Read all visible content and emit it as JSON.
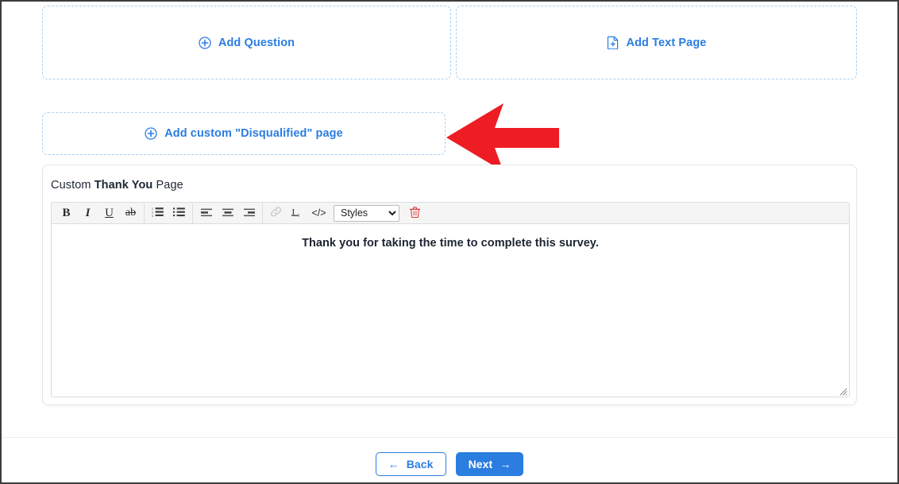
{
  "colors": {
    "accent_blue": "#2b7de0",
    "dashed_border": "#a9d2f3",
    "annotation_red": "#ee1c23",
    "toolbar_bg": "#f5f5f5",
    "card_border": "#e4e7eb",
    "trash_red": "#e03a3a"
  },
  "add_buttons": {
    "add_question": {
      "label": "Add Question",
      "icon": "plus-circle-icon"
    },
    "add_text_page": {
      "label": "Add Text Page",
      "icon": "file-plus-icon"
    },
    "add_disqualified": {
      "label": "Add custom \"Disqualified\" page",
      "icon": "plus-circle-icon"
    }
  },
  "annotation": {
    "type": "arrow",
    "direction": "left",
    "color": "#ee1c23",
    "points_at": "add custom \"Disqualified\" page"
  },
  "thank_you_card": {
    "title_prefix": "Custom ",
    "title_bold": "Thank You",
    "title_suffix": " Page",
    "editor": {
      "toolbar": [
        {
          "name": "bold-button",
          "glyph": "B",
          "label": "Bold",
          "disabled": false
        },
        {
          "name": "italic-button",
          "glyph": "I",
          "label": "Italic",
          "disabled": false
        },
        {
          "name": "underline-button",
          "glyph": "U",
          "label": "Underline",
          "disabled": false
        },
        {
          "name": "strikethrough-button",
          "glyph": "ab",
          "label": "Strikethrough",
          "disabled": false
        },
        {
          "name": "numbered-list-button",
          "glyph": "",
          "label": "Insert/Remove Numbered List",
          "disabled": false
        },
        {
          "name": "bulleted-list-button",
          "glyph": "",
          "label": "Insert/Remove Bulleted List",
          "disabled": false
        },
        {
          "name": "align-left-button",
          "glyph": "",
          "label": "Align Left",
          "disabled": false
        },
        {
          "name": "align-center-button",
          "glyph": "",
          "label": "Center",
          "disabled": false
        },
        {
          "name": "align-right-button",
          "glyph": "",
          "label": "Align Right",
          "disabled": false
        },
        {
          "name": "link-button",
          "glyph": "",
          "label": "Link",
          "disabled": true
        },
        {
          "name": "remove-format-button",
          "glyph": "Ix",
          "label": "Remove Format",
          "disabled": false
        },
        {
          "name": "source-code-button",
          "glyph": "</>",
          "label": "Source",
          "disabled": false
        },
        {
          "name": "delete-button",
          "glyph": "trash",
          "label": "Delete",
          "disabled": false
        }
      ],
      "styles_select": {
        "selected": "Styles",
        "options": [
          "Styles"
        ]
      },
      "content": "Thank you for taking the time to complete this survey.",
      "content_bold": true,
      "content_align": "center"
    }
  },
  "footer": {
    "back_button": {
      "label": "Back",
      "icon": "arrow-left-icon"
    },
    "next_button": {
      "label": "Next",
      "icon": "arrow-right-icon"
    }
  }
}
